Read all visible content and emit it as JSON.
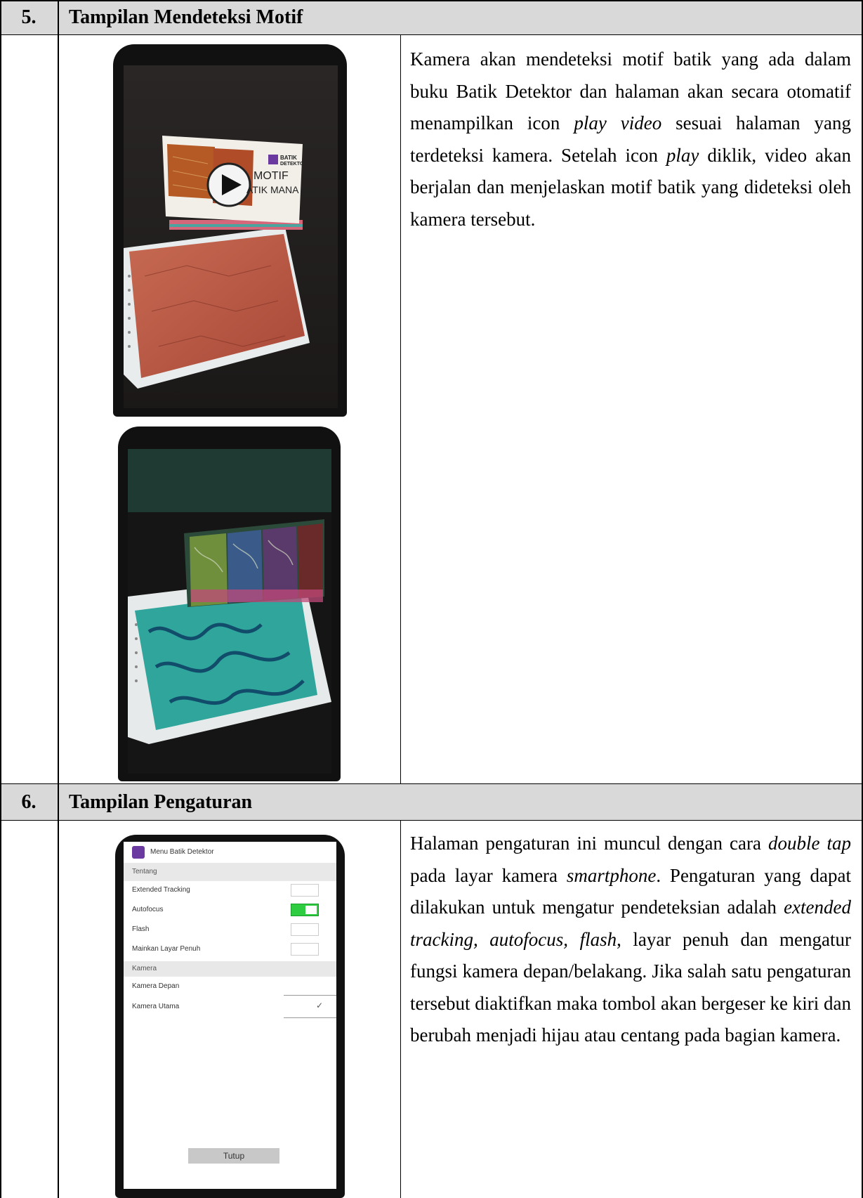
{
  "rows": [
    {
      "number": "5.",
      "title": "Tampilan Mendeteksi Motif",
      "description": [
        {
          "t": "Kamera akan mendeteksi motif batik yang ada dalam buku Batik Detektor dan halaman akan secara otomatif menampilkan icon "
        },
        {
          "t": "play video",
          "i": true
        },
        {
          "t": " sesuai halaman yang terdeteksi kamera. Setelah icon "
        },
        {
          "t": "play",
          "i": true
        },
        {
          "t": " diklik, video akan berjalan dan menjelaskan motif batik yang dideteksi oleh kamera tersebut."
        }
      ],
      "ar_card_text": {
        "brand_line1": "BATIK",
        "brand_line2": "DETEKTOR",
        "motif": "MOTIF",
        "caption": "ATIK MANA INI?"
      }
    },
    {
      "number": "6.",
      "title": "Tampilan Pengaturan",
      "description": [
        {
          "t": "Halaman pengaturan ini muncul dengan cara "
        },
        {
          "t": "double tap",
          "i": true
        },
        {
          "t": " pada layar kamera "
        },
        {
          "t": "smartphone",
          "i": true
        },
        {
          "t": ". Pengaturan yang dapat dilakukan untuk mengatur pendeteksian adalah "
        },
        {
          "t": "extended tracking, autofocus, flash",
          "i": true
        },
        {
          "t": ", layar penuh dan mengatur fungsi kamera depan/belakang. Jika salah satu pengaturan tersebut diaktifkan maka tombol akan bergeser ke kiri dan berubah menjadi hijau atau centang pada bagian kamera."
        }
      ],
      "settings": {
        "menu_title": "Menu Batik Detektor",
        "section_about": "Tentang",
        "items": [
          {
            "label": "Extended Tracking",
            "on": false
          },
          {
            "label": "Autofocus",
            "on": true
          },
          {
            "label": "Flash",
            "on": false
          },
          {
            "label": "Mainkan Layar Penuh",
            "on": false
          }
        ],
        "section_camera": "Kamera",
        "cameras": [
          {
            "label": "Kamera Depan",
            "checked": false
          },
          {
            "label": "Kamera Utama",
            "checked": true
          }
        ],
        "check_mark": "✓",
        "close_label": "Tutup",
        "toggle_on_color": "#2ecc40"
      }
    }
  ]
}
